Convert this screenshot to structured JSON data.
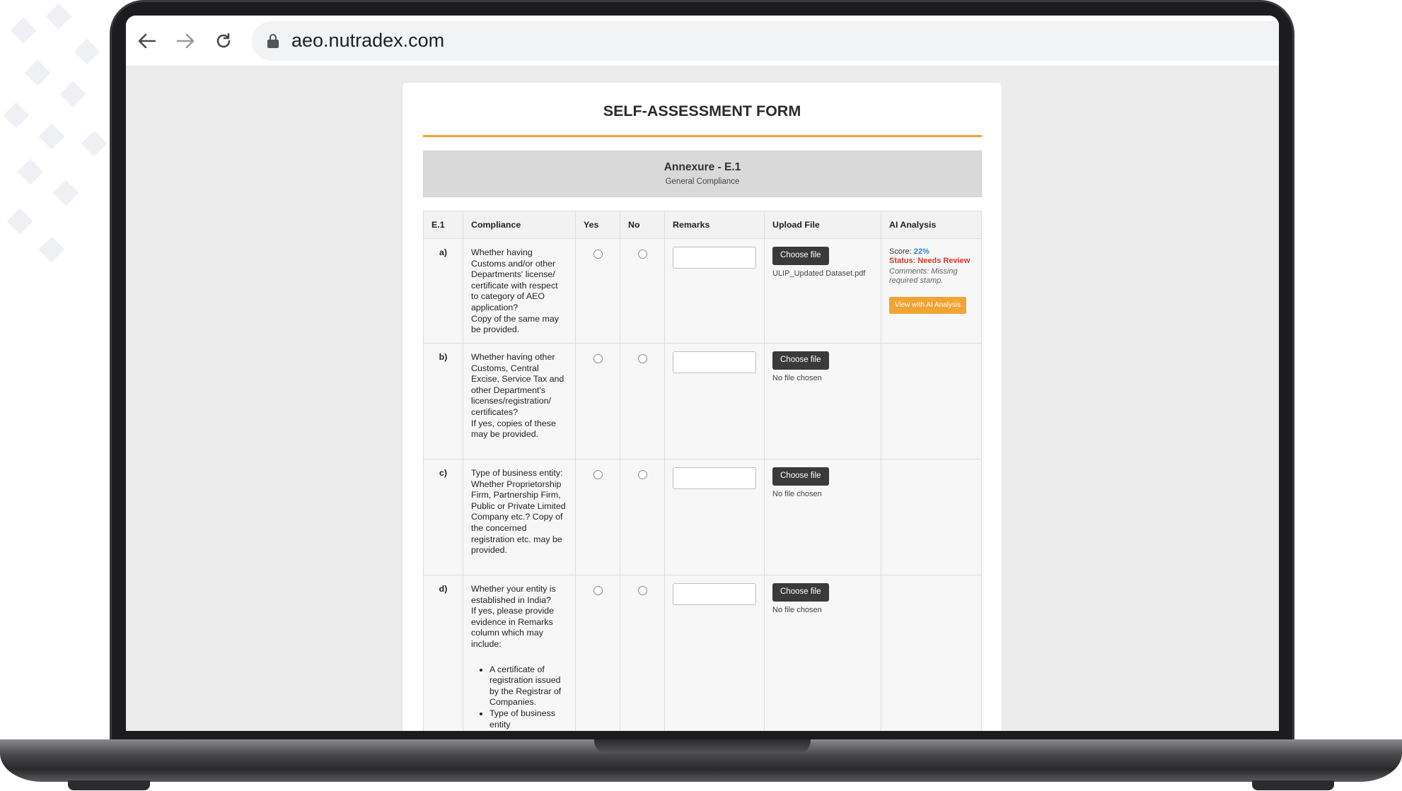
{
  "browser": {
    "url": "aeo.nutradex.com"
  },
  "form": {
    "title": "SELF-ASSESSMENT FORM",
    "annexure_title": "Annexure - E.1",
    "annexure_subtitle": "General Compliance",
    "accent_color": "#f0a433"
  },
  "table": {
    "headers": [
      "E.1",
      "Compliance",
      "Yes",
      "No",
      "Remarks",
      "Upload File",
      "AI Analysis"
    ],
    "choose_file_label": "Choose file",
    "rows": [
      {
        "id": "a)",
        "compliance": "Whether having Customs and/or other Departments' license/ certificate with respect to category of AEO application?\nCopy of the same may be provided.",
        "file": "ULIP_Updated Dataset.pdf",
        "ai": {
          "score_label": "Score:",
          "score_value": "22%",
          "status": "Status: Needs Review",
          "comments": "Comments: Missing required stamp.",
          "button": "View with AI Analysis"
        }
      },
      {
        "id": "b)",
        "compliance": "Whether having other Customs, Central Excise, Service Tax and other Department's licenses/registration/ certificates?\nIf yes, copies of these may be provided.",
        "file": "No file chosen"
      },
      {
        "id": "c)",
        "compliance": "Type of business entity:\nWhether Proprietorship Firm, Partnership Firm, Public or Private Limited Company etc.? Copy of the concerned registration etc. may be provided.",
        "file": "No file chosen"
      },
      {
        "id": "d)",
        "compliance": "Whether your entity is established in India?\nIf yes, please provide evidence in Remarks column which may include:",
        "bullets": [
          "A certificate of registration issued by the Registrar of Companies.",
          "Type of business entity"
        ],
        "file": "No file chosen"
      }
    ]
  }
}
